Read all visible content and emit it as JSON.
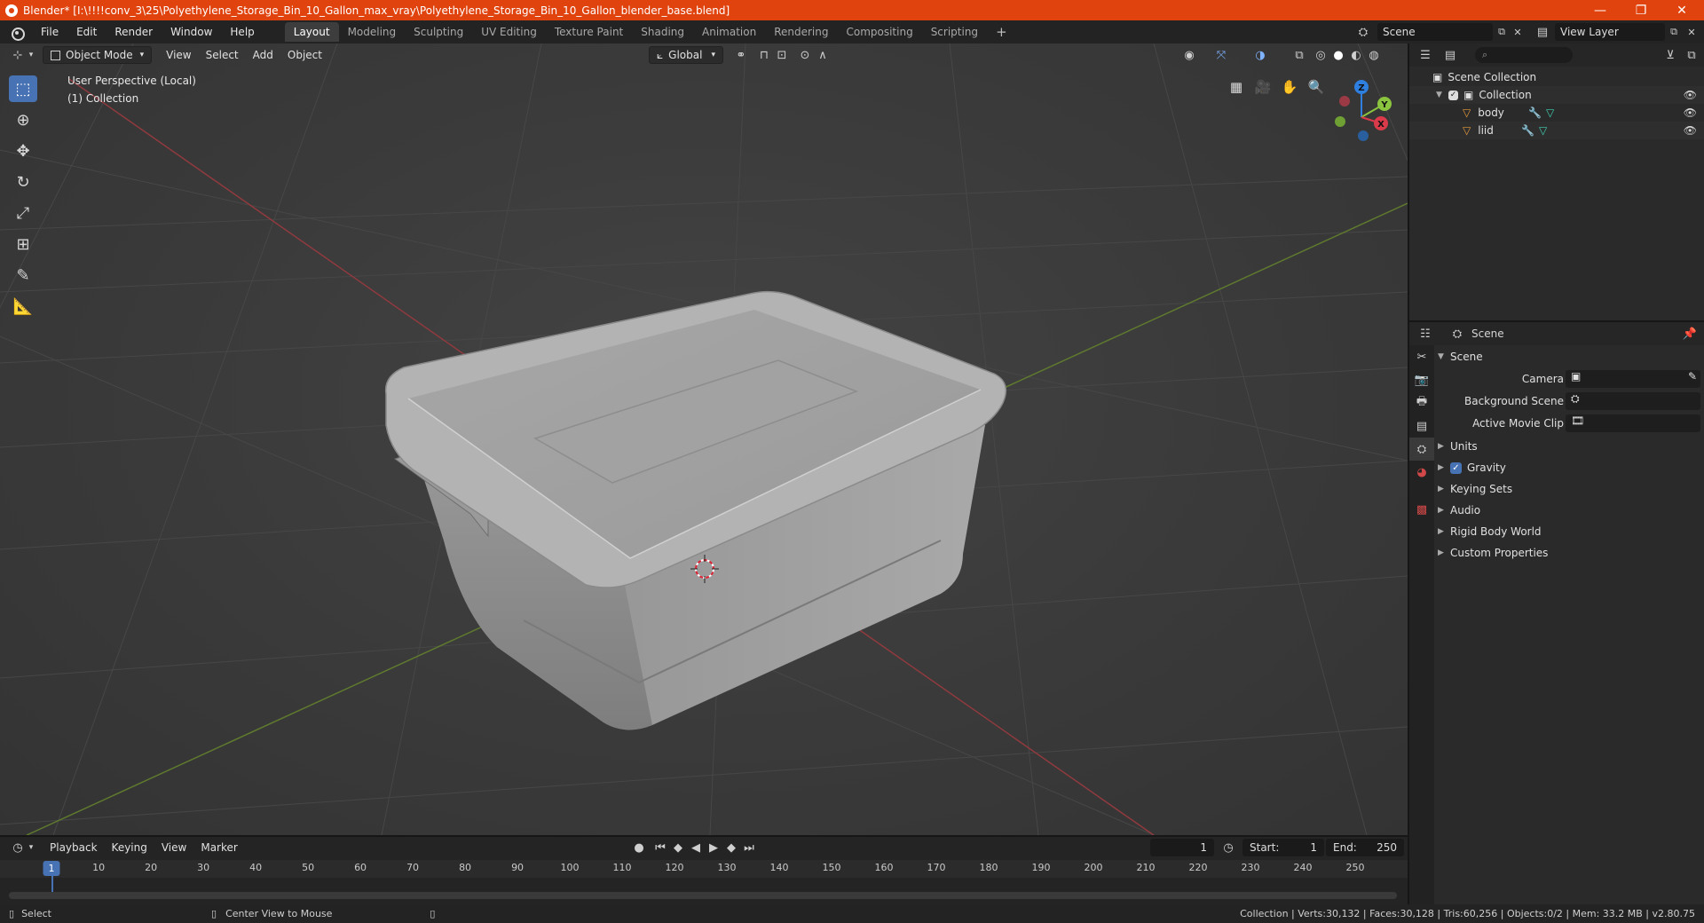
{
  "window": {
    "title": "Blender* [I:\\!!!!conv_3\\25\\Polyethylene_Storage_Bin_10_Gallon_max_vray\\Polyethylene_Storage_Bin_10_Gallon_blender_base.blend]",
    "minimize": "—",
    "maximize": "❐",
    "close": "✕"
  },
  "menu": [
    "File",
    "Edit",
    "Render",
    "Window",
    "Help"
  ],
  "workspaces": [
    "Layout",
    "Modeling",
    "Sculpting",
    "UV Editing",
    "Texture Paint",
    "Shading",
    "Animation",
    "Rendering",
    "Compositing",
    "Scripting"
  ],
  "workspace_add": "+",
  "scene_selector": "Scene",
  "view_layer_selector": "View Layer",
  "viewport": {
    "mode": "Object Mode",
    "menus": [
      "View",
      "Select",
      "Add",
      "Object"
    ],
    "orientation": "Global",
    "perspective_label": "User Perspective (Local)",
    "collection_label": "(1) Collection",
    "gizmo": {
      "x": "X",
      "y": "Y",
      "z": "Z"
    }
  },
  "outliner": {
    "search_placeholder": "",
    "root": "Scene Collection",
    "collection": "Collection",
    "objects": [
      "body",
      "liid"
    ]
  },
  "properties": {
    "header": "Scene",
    "panel_title": "Scene",
    "fields": [
      {
        "label": "Camera"
      },
      {
        "label": "Background Scene"
      },
      {
        "label": "Active Movie Clip"
      }
    ],
    "sections": [
      "Units",
      "Gravity",
      "Keying Sets",
      "Audio",
      "Rigid Body World",
      "Custom Properties"
    ],
    "gravity_checked": true
  },
  "timeline": {
    "menus": [
      "Playback",
      "Keying",
      "View",
      "Marker"
    ],
    "current_frame": "1",
    "start_label": "Start:",
    "start": "1",
    "end_label": "End:",
    "end": "250",
    "ticks": [
      "1",
      "10",
      "20",
      "30",
      "40",
      "50",
      "60",
      "70",
      "80",
      "90",
      "100",
      "110",
      "120",
      "130",
      "140",
      "150",
      "160",
      "170",
      "180",
      "190",
      "200",
      "210",
      "220",
      "230",
      "240",
      "250"
    ]
  },
  "statusbar": {
    "left_action": "Select",
    "middle_action": "Center View to Mouse",
    "stats": "Collection | Verts:30,132 | Faces:30,128 | Tris:60,256 | Objects:0/2 | Mem: 33.2 MB | v2.80.75"
  },
  "colors": {
    "accent": "#4772b3",
    "titlebar": "#e0430e",
    "x_axis": "#db3a4a",
    "y_axis": "#8bc43f",
    "z_axis": "#2f7fe0"
  }
}
